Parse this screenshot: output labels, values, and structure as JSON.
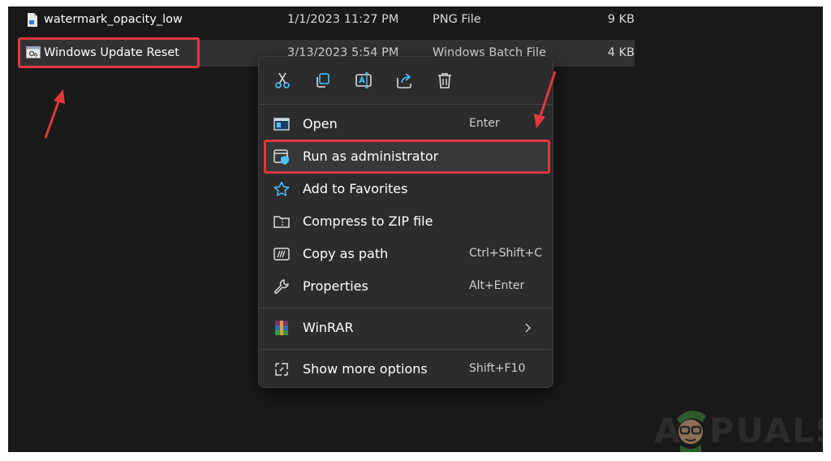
{
  "files": [
    {
      "name": "watermark_opacity_low",
      "date": "1/1/2023 11:27 PM",
      "type": "PNG File",
      "size": "9 KB"
    },
    {
      "name": "Windows Update Reset",
      "date": "3/13/2023 5:54 PM",
      "type": "Windows Batch File",
      "size": "4 KB"
    }
  ],
  "menu": {
    "toolbar": [
      {
        "name": "cut",
        "icon": "scissors-icon"
      },
      {
        "name": "copy",
        "icon": "copy-icon"
      },
      {
        "name": "rename",
        "icon": "rename-icon"
      },
      {
        "name": "share",
        "icon": "share-icon"
      },
      {
        "name": "delete",
        "icon": "trash-icon"
      }
    ],
    "items": [
      {
        "label": "Open",
        "shortcut": "Enter",
        "icon": "open-window-icon"
      },
      {
        "label": "Run as administrator",
        "shortcut": "",
        "icon": "shield-window-icon"
      },
      {
        "label": "Add to Favorites",
        "shortcut": "",
        "icon": "star-icon"
      },
      {
        "label": "Compress to ZIP file",
        "shortcut": "",
        "icon": "zip-folder-icon"
      },
      {
        "label": "Copy as path",
        "shortcut": "Ctrl+Shift+C",
        "icon": "path-icon"
      },
      {
        "label": "Properties",
        "shortcut": "Alt+Enter",
        "icon": "wrench-icon"
      }
    ],
    "winrar": {
      "label": "WinRAR",
      "icon": "winrar-icon"
    },
    "more": {
      "label": "Show more options",
      "shortcut": "Shift+F10",
      "icon": "more-options-icon"
    }
  },
  "watermark": {
    "text_left": "A",
    "text_right": "PUALS"
  },
  "colors": {
    "highlight": "#e0383e",
    "accent": "#4cc2ff",
    "menu_bg": "#2c2c2c",
    "explorer_bg": "#191919"
  }
}
